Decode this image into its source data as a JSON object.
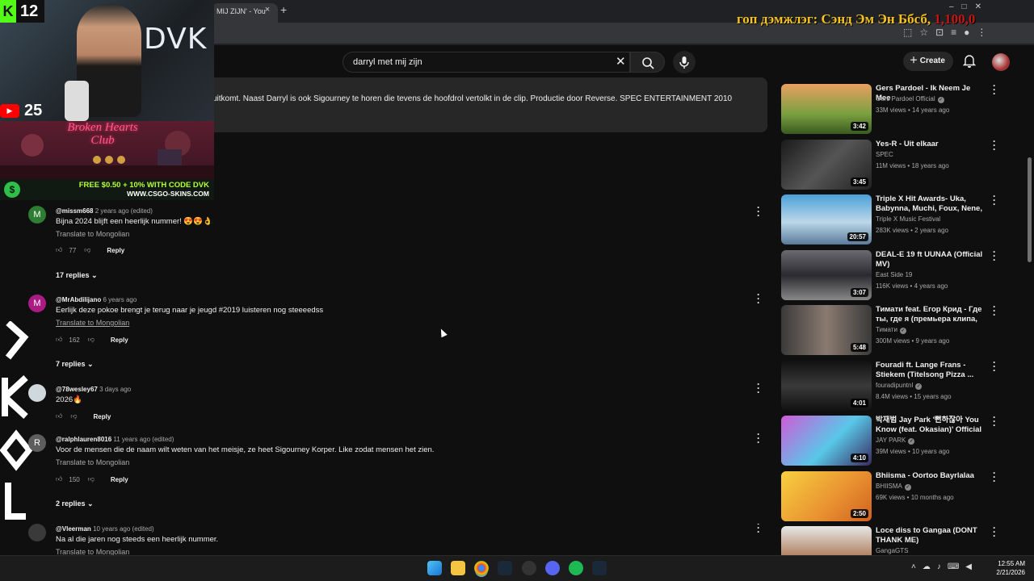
{
  "browser": {
    "tab_title": "MIJ ZIJN' - You",
    "close_glyph": "×",
    "new_tab_glyph": "+",
    "overlay_title_main": "гоп дэмжлэг: Сэнд Эм Эн Ббсб,",
    "overlay_title_amount": "1,100,0"
  },
  "header": {
    "search_value": "darryl met mij zijn",
    "clear_glyph": "✕",
    "create_label": "Create"
  },
  "description": {
    "text": "uitkomt. Naast Darryl is ook Sigourney te horen die tevens de hoofdrol vertolkt in de clip. Productie door Reverse. SPEC ENTERTAINMENT 2010"
  },
  "stream_overlay": {
    "kick_count": "12",
    "youtube_count": "25",
    "streamer_tag": "DVK",
    "art_text": "Broken Hearts Club",
    "promo_line1": "FREE $0.50 + 10% WITH CODE DVK",
    "promo_line2": "WWW.CSGO-SKINS.COM"
  },
  "comments": [
    {
      "avatar_letter": "M",
      "avatar_color": "#2e7d32",
      "author": "@missm668",
      "time": "2 years ago (edited)",
      "text": "Bijna 2024 blijft een heerlijk nummer! 😍😍👌",
      "translate": "Translate to Mongolian",
      "likes": "77",
      "reply": "Reply",
      "replies": "17 replies"
    },
    {
      "avatar_letter": "M",
      "avatar_color": "#ab1b84",
      "author": "@MrAbdilijano",
      "time": "6 years ago",
      "text": "Eerlijk deze pokoe brengt je terug naar je jeugd #2019 luisteren nog steeeedss",
      "translate": "Translate to Mongolian",
      "likes": "162",
      "reply": "Reply",
      "replies": "7 replies"
    },
    {
      "avatar_letter": "",
      "avatar_color": "#cfd8dc",
      "author": "@78wesley67",
      "time": "3 days ago",
      "text": "2026🔥",
      "translate": "",
      "likes": "",
      "reply": "Reply",
      "replies": ""
    },
    {
      "avatar_letter": "R",
      "avatar_color": "#5d5d5d",
      "author": "@ralphlauren8016",
      "time": "11 years ago (edited)",
      "text": "Voor de mensen die de naam wilt weten van het meisje, ze heet Sigourney Korper. Like zodat mensen het zien.",
      "translate": "Translate to Mongolian",
      "likes": "150",
      "reply": "Reply",
      "replies": "2 replies"
    },
    {
      "avatar_letter": "",
      "avatar_color": "#3a3a3a",
      "author": "@Vleerman",
      "time": "10 years ago (edited)",
      "text": "Na al die jaren nog steeds een heerlijk nummer.",
      "translate": "Translate to Mongolian",
      "likes": "",
      "reply": "",
      "replies": ""
    }
  ],
  "sidebar_videos": [
    {
      "title": "Gers Pardoel - Ik Neem Je Mee",
      "channel": "Gers Pardoel Official",
      "verified": true,
      "meta": "33M views • 14 years ago",
      "duration": "3:42",
      "thumb": "linear-gradient(180deg,#e8a060,#7aa040 60%,#3a5a20)"
    },
    {
      "title": "Yes-R - Uit elkaar",
      "channel": "SPEC",
      "verified": false,
      "meta": "11M views • 18 years ago",
      "duration": "3:45",
      "thumb": "linear-gradient(135deg,#1a1a1a,#555 50%,#222)"
    },
    {
      "title": "Triple X Hit Awards- Uka, Babynna, Muchi, Foux, Nene, ...",
      "channel": "Triple X Music Festival",
      "verified": false,
      "meta": "283K views • 2 years ago",
      "duration": "20:57",
      "thumb": "linear-gradient(180deg,#4aa0d8,#bcd8e8 55%,#5a7a9a)"
    },
    {
      "title": "DEAL-E 19 ft UUNAA (Official MV)",
      "channel": "East Side 19",
      "verified": false,
      "meta": "116K views • 4 years ago",
      "duration": "3:07",
      "thumb": "linear-gradient(180deg,#6a6a70,#2a2a30 50%,#888)"
    },
    {
      "title": "Тимати feat. Егор Крид - Где ты, где я (премьера клипа, ...",
      "channel": "Тимати",
      "verified": true,
      "meta": "300M views • 9 years ago",
      "duration": "5:48",
      "thumb": "linear-gradient(90deg,#3a3a3a,#8a7a70 50%,#3a3a3a)"
    },
    {
      "title": "Fouradi ft. Lange Frans - Stiekem (Titelsong Pizza ...",
      "channel": "fouradipuntnl",
      "verified": true,
      "meta": "8.4M views • 15 years ago",
      "duration": "4:01",
      "thumb": "linear-gradient(180deg,#111,#3a3a3a 50%,#111)"
    },
    {
      "title": "박재범 Jay Park '뻔하잖아 You Know (feat. Okasian)' Official ...",
      "channel": "JAY PARK",
      "verified": true,
      "meta": "39M views • 10 years ago",
      "duration": "4:10",
      "thumb": "linear-gradient(135deg,#d05ad8,#58c8e8 55%,#3a2a60)"
    },
    {
      "title": "Bhiisma - Oortoo Bayrlalaa",
      "channel": "BHIISMA",
      "verified": true,
      "meta": "69K views • 10 months ago",
      "duration": "2:50",
      "thumb": "linear-gradient(135deg,#f8d040,#e89030 60%,#d06020)"
    },
    {
      "title": "Loce diss to Gangaa (DONT THANK ME)",
      "channel": "GangaGTS",
      "verified": false,
      "meta": "",
      "duration": "",
      "thumb": "linear-gradient(180deg,#e8e8e8,#b08060 60%,#888)"
    }
  ],
  "taskbar": {
    "time": "12:55 AM",
    "date": "2/21/2026"
  },
  "colors": {
    "accent_red": "#ff0000",
    "kick_green": "#53fc18",
    "overlay_gold": "#f6c21c"
  }
}
